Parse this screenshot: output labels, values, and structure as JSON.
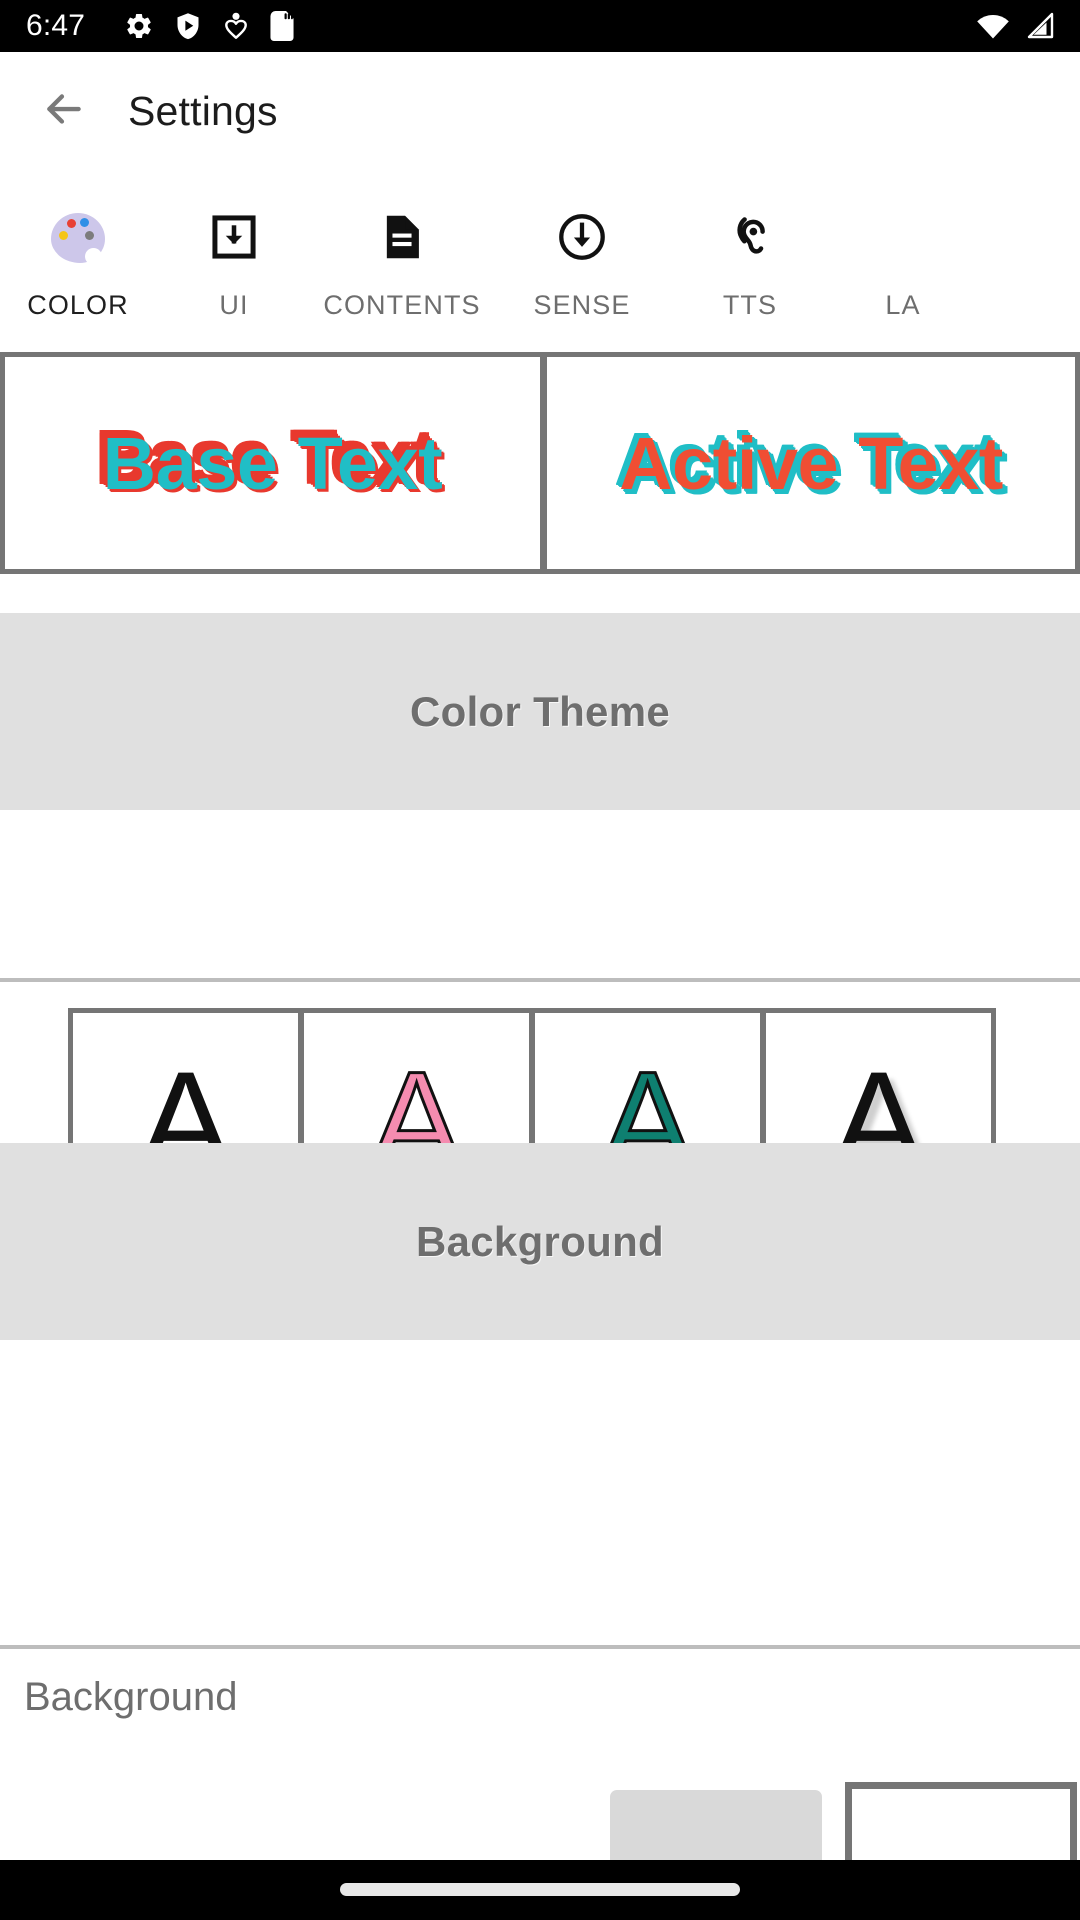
{
  "status_bar": {
    "time": "6:47",
    "left_icons": [
      "gear-icon",
      "play-protect-shield-icon",
      "person-heart-icon",
      "sd-card-icon"
    ],
    "right_icons": [
      "wifi-icon",
      "cellular-signal-icon"
    ],
    "background": "#000000",
    "foreground": "#ffffff"
  },
  "toolbar": {
    "back_icon": "back-arrow-icon",
    "title": "Settings"
  },
  "tabs": {
    "active_index": 0,
    "indicator_color": "#8cc2f0",
    "items": [
      {
        "label": "COLOR",
        "icon": "palette-icon"
      },
      {
        "label": "UI",
        "icon": "download-box-icon"
      },
      {
        "label": "CONTENTS",
        "icon": "document-lines-icon"
      },
      {
        "label": "SENSE",
        "icon": "arrow-down-circle-icon"
      },
      {
        "label": "TTS",
        "icon": "ear-hearing-icon"
      },
      {
        "label": "LA",
        "icon": "cut-off-icon"
      }
    ]
  },
  "preview": {
    "base": {
      "text": "Base Text",
      "fill_color": "#20bec6",
      "outline_color": "#e8392e"
    },
    "active": {
      "text": "Active Text",
      "fill_color": "#f04e33",
      "outline_color": "#20bec6"
    }
  },
  "color_theme_section": {
    "title": "Color Theme",
    "band_color": "#e0e0e0",
    "swatches": [
      {
        "glyph": "A",
        "fill": "#111111",
        "stroke": "#111111",
        "name": "theme-black"
      },
      {
        "glyph": "A",
        "fill": "#f58cb0",
        "stroke": "#111111",
        "name": "theme-pink"
      },
      {
        "glyph": "A",
        "fill": "#0e7f70",
        "stroke": "#111111",
        "name": "theme-teal"
      },
      {
        "glyph": "A",
        "fill": "#111111",
        "stroke": "#cfcfcf",
        "name": "theme-black-shadow"
      }
    ]
  },
  "background_section": {
    "title": "Background",
    "band_color": "#e0e0e0",
    "row_label": "Background",
    "swatch_gray": "#d9d9d9",
    "swatch_outline_border": "#757575"
  },
  "nav_bar": {
    "gesture_pill": "home-gesture-pill"
  }
}
